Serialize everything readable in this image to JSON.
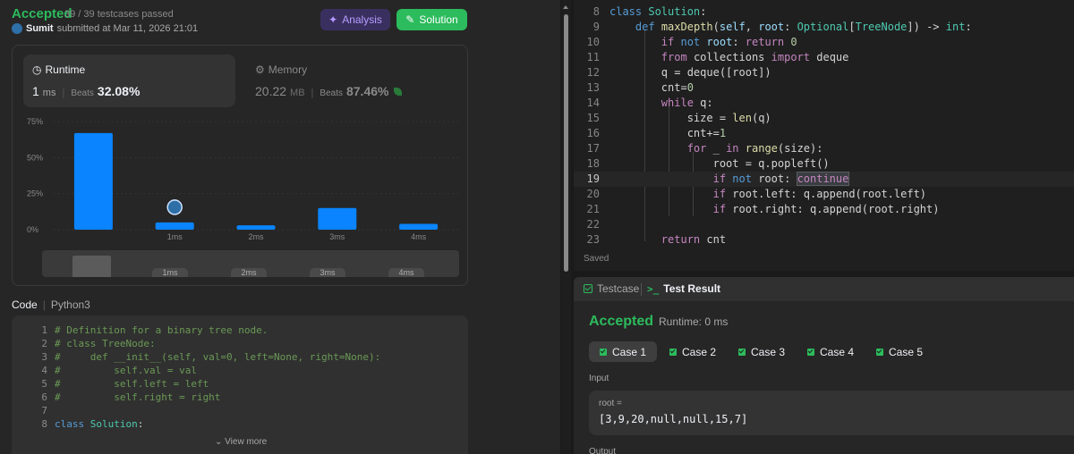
{
  "submission": {
    "status": "Accepted",
    "testcases": "39 / 39 testcases passed",
    "user": "Sumit",
    "submitted_text": "submitted at Mar 11, 2026 21:01",
    "analysis_label": "Analysis",
    "solution_label": "Solution"
  },
  "runtime": {
    "label": "Runtime",
    "value": "1",
    "unit": "ms",
    "beats_label": "Beats",
    "beats_value": "32.08%"
  },
  "memory": {
    "label": "Memory",
    "value": "20.22",
    "unit": "MB",
    "beats_label": "Beats",
    "beats_value": "87.46%"
  },
  "chart_data": {
    "type": "bar",
    "categories": [
      "",
      "1ms",
      "2ms",
      "3ms",
      "4ms"
    ],
    "values": [
      67,
      5,
      3,
      15,
      4
    ],
    "ylabel": "",
    "yticks": [
      "0%",
      "25%",
      "50%",
      "75%"
    ],
    "ylim": [
      0,
      75
    ],
    "user_marker_category": "1ms",
    "bar_color": "#0a84ff",
    "grid": true
  },
  "navigator_ticks": [
    "1ms",
    "2ms",
    "3ms",
    "4ms"
  ],
  "code_section": {
    "label": "Code",
    "language": "Python3",
    "view_more": "View more",
    "lines": [
      {
        "n": "1",
        "text": "# Definition for a binary tree node."
      },
      {
        "n": "2",
        "text": "# class TreeNode:"
      },
      {
        "n": "3",
        "text": "#     def __init__(self, val=0, left=None, right=None):"
      },
      {
        "n": "4",
        "text": "#         self.val = val"
      },
      {
        "n": "5",
        "text": "#         self.left = left"
      },
      {
        "n": "6",
        "text": "#         self.right = right"
      },
      {
        "n": "7",
        "text": ""
      },
      {
        "n": "8",
        "text": "class Solution:"
      }
    ]
  },
  "editor": {
    "saved_label": "Saved",
    "current_line": "19",
    "line_numbers": [
      "8",
      "9",
      "10",
      "11",
      "12",
      "13",
      "14",
      "15",
      "16",
      "17",
      "18",
      "19",
      "20",
      "21",
      "22",
      "23"
    ]
  },
  "result_panel": {
    "tab_testcase": "Testcase",
    "tab_result": "Test Result",
    "status": "Accepted",
    "runtime": "Runtime: 0 ms",
    "cases": [
      "Case 1",
      "Case 2",
      "Case 3",
      "Case 4",
      "Case 5"
    ],
    "input_label": "Input",
    "input_name": "root =",
    "input_value": "[3,9,20,null,null,15,7]",
    "output_label": "Output"
  },
  "colors": {
    "accent_green": "#2cbb5d",
    "bar_blue": "#0a84ff",
    "analysis_purple": "#b69cff"
  }
}
